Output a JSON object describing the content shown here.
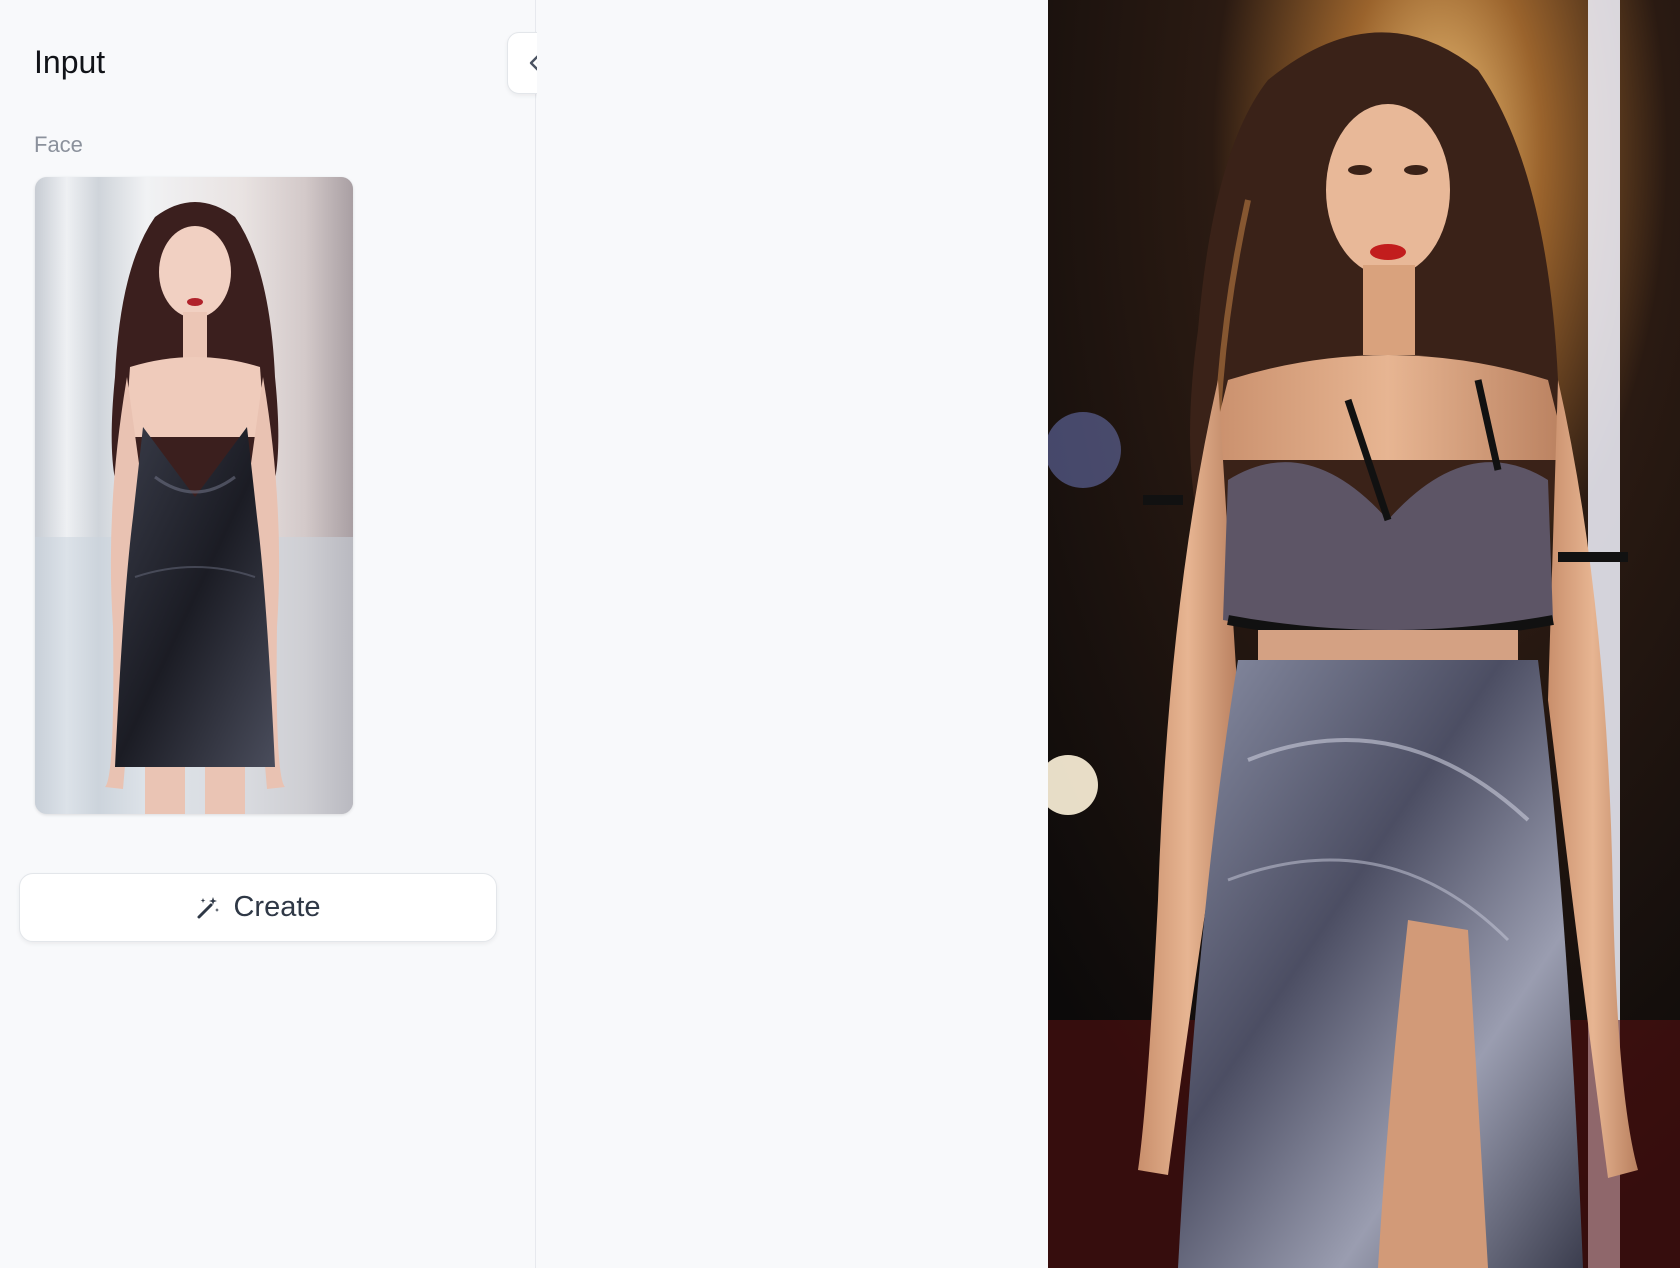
{
  "input_panel": {
    "title": "Input",
    "face_label": "Face",
    "create_button_label": "Create"
  },
  "icons": {
    "collapse": "chevrons-left-icon",
    "create": "magic-wand-icon"
  }
}
